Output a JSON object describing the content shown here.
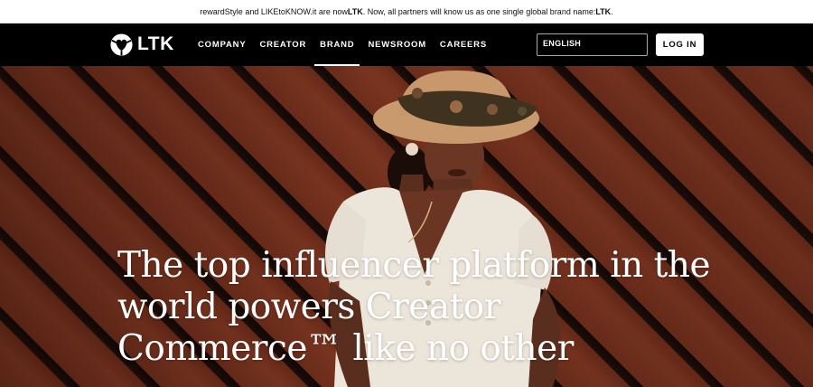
{
  "announcement": {
    "part1": "rewardStyle and LIKEtoKNOW.it are now ",
    "brand1": "LTK",
    "part2": ". Now, all partners will know us as one single global brand name: ",
    "brand2": "LTK",
    "part3": "."
  },
  "nav": {
    "logo_text": "LTK",
    "links": [
      {
        "label": "COMPANY"
      },
      {
        "label": "CREATOR"
      },
      {
        "label": "BRAND"
      },
      {
        "label": "NEWSROOM"
      },
      {
        "label": "CAREERS"
      }
    ],
    "active_link": "BRAND",
    "language": "ENGLISH",
    "login_label": "LOG IN"
  },
  "hero": {
    "title": "The top influencer platform in the world powers Creator Commerce™ like no other"
  },
  "colors": {
    "nav_bg": "#000000",
    "hero_wood": "#6d2d1b",
    "text_light": "#ffffff"
  },
  "icons": {
    "logo": "ltk-heart-logo-icon"
  }
}
